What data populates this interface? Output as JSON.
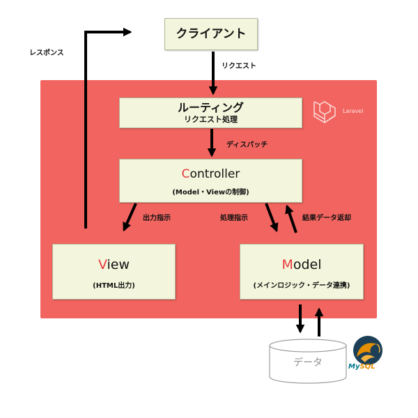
{
  "client": {
    "label": "クライアント"
  },
  "routing": {
    "label": "ルーティング",
    "sub": "リクエスト処理"
  },
  "controller": {
    "initial": "C",
    "rest": "ontroller",
    "sub": "(Model・Viewの制御)"
  },
  "view": {
    "initial": "V",
    "rest": "iew",
    "sub": "(HTML出力)"
  },
  "model": {
    "initial": "M",
    "rest": "odel",
    "sub": "(メインロジック・データ連携)"
  },
  "arrows": {
    "response": "レスポンス",
    "request": "リクエスト",
    "dispatch": "ディスパッチ",
    "output_instruction": "出力指示",
    "process_instruction": "処理指示",
    "result_return": "結果データ返却"
  },
  "laravel": {
    "text": "Laravel",
    "icon": "laravel-logo-icon"
  },
  "datastore": {
    "label": "データ"
  },
  "mysql": {
    "prefix": "My",
    "suffix": "SQL",
    "icon": "mysql-dolphin-icon"
  },
  "colors": {
    "framework": "#f2645f",
    "box": "#f3f6dc",
    "accent": "#e8383d",
    "arrow": "#000000",
    "mysql_blue": "#00758f",
    "mysql_orange": "#e48e00"
  }
}
